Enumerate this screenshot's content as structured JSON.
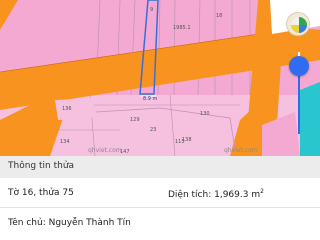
{
  "map": {
    "parcel_labels": [
      "18",
      "9",
      "1985.1",
      "8.9 m",
      "136",
      "129",
      "23",
      "130",
      "147",
      "115",
      "134",
      "138"
    ],
    "watermarks": [
      "qhviet.com",
      "qhviet.com"
    ],
    "colors": {
      "residential": "#f3a9d2",
      "road": "#f7931e",
      "road_edge": "#d06a10",
      "selected_parcel": "#3a6fd8",
      "teal_zone": "#29c6cf"
    }
  },
  "controls": {
    "layer_icon": "layers-icon",
    "opacity_label": "",
    "opacity_level": 0.83
  },
  "info": {
    "title": "Thông tin thửa",
    "parcel": "Tờ 16, thửa 75",
    "area_label": "Diện tích: 1,969.3 m",
    "area_unit_sup": "2",
    "owner": "Tên chủ: Nguyễn Thành Tín"
  }
}
